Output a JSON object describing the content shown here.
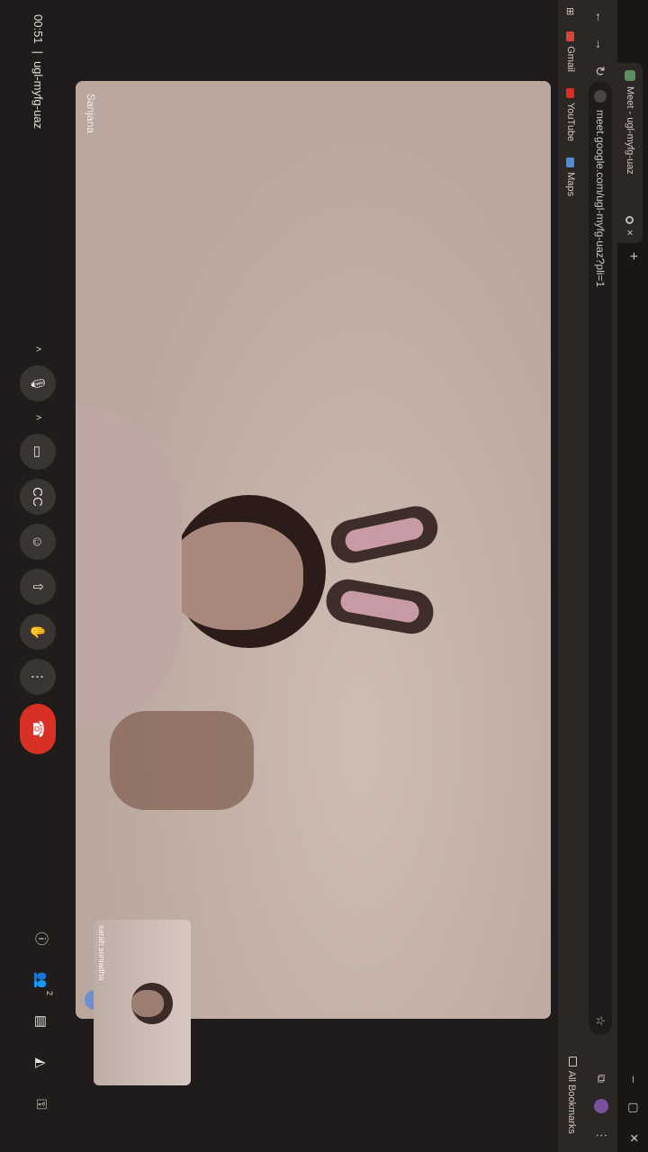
{
  "browser": {
    "tab_title": "Meet - ugl-myfg-uaz",
    "tab_close": "×",
    "new_tab": "+",
    "window_controls": [
      "–",
      "▢",
      "✕"
    ],
    "url": "meet.google.com/ugl-myfg-uaz?pli=1",
    "bookmarks": [
      {
        "label": "Gmail",
        "color": "#d44638"
      },
      {
        "label": "YouTube",
        "color": "#e02b20"
      },
      {
        "label": "Maps",
        "color": "#4f8cd8"
      }
    ],
    "all_bookmarks": "All Bookmarks"
  },
  "meet": {
    "main_participant": "Sanjana",
    "self_participant": "sarah.soniadha",
    "meeting_time": "00:51",
    "separator": "|",
    "meeting_code": "ugl-myfg-uaz",
    "participant_count": "2"
  },
  "colors": {
    "hangup": "#d93025",
    "more_button": "#6d8fd0",
    "control_bg": "#3a3432"
  }
}
